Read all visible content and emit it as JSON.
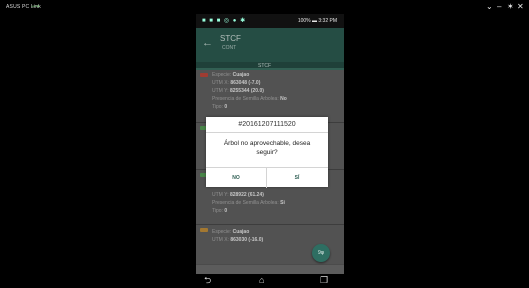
{
  "window": {
    "title": "ASUS PC Link",
    "controls": [
      "⌄",
      "–",
      "✶",
      "✕"
    ]
  },
  "status_bar": {
    "icons": "■ ■ ■ ◎  ● ✱",
    "right_text": "100% ▬ 3:32 PM"
  },
  "app_bar": {
    "title": "STCF",
    "subtitle": "CONT"
  },
  "tab": {
    "label": "STCF"
  },
  "list": {
    "item1": {
      "badge": "",
      "species_label": "Especie:",
      "species": "Cuajao",
      "utm_x_label": "UTM X:",
      "utm_x": "863048 (-7.0)",
      "utm_y_label": "UTM Y:",
      "utm_y": "8255344 (20.0)",
      "presence_label": "Presencia de Semilla Arbolea:",
      "presence": "No",
      "type_label": "Tipo:",
      "type": "0"
    },
    "item2": {
      "badge": "",
      "utm_y_label": "UTM Y:",
      "utm_y": "828922 (61.24)",
      "presence_label": "Presencia de Semilla Arbolea:",
      "presence": "Si",
      "type_label": "Tipo:",
      "type": "0"
    },
    "item3": {
      "badge": "",
      "species_label": "Especie:",
      "species": "Cuajao",
      "utm_x_label": "UTM X:",
      "utm_x": "863030 (-16.0)"
    }
  },
  "dialog": {
    "title": "#20161207111520",
    "message": "Árbol no aprovechable, desea seguir?",
    "no_label": "NO",
    "si_label": "SÍ"
  },
  "fab": {
    "label": "9φ"
  },
  "nav": {
    "back": "⮌",
    "home": "⌂",
    "recents": "❐"
  }
}
